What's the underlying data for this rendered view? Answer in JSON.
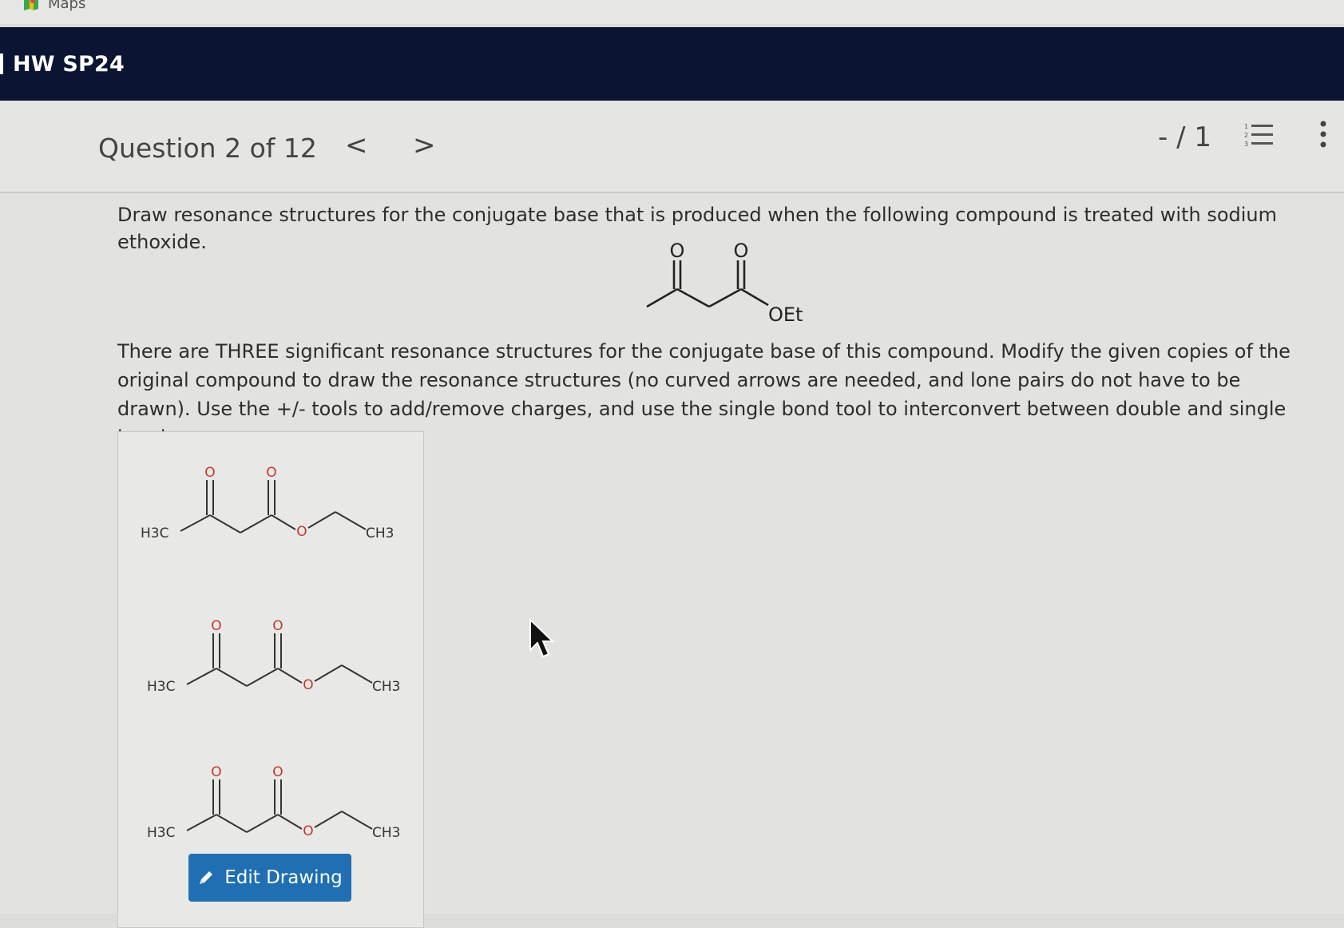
{
  "bookmarks": {
    "maps_label": "Maps",
    "icon": "maps-icon"
  },
  "header": {
    "title": "HW SP24"
  },
  "question_nav": {
    "label": "Question 2 of 12",
    "prev": "<",
    "next": ">",
    "score": "- / 1",
    "icons": [
      "prev-chevron-icon",
      "next-chevron-icon",
      "numbered-list-icon",
      "more-vertical-icon"
    ]
  },
  "question": {
    "prompt": "Draw resonance structures for the conjugate base that is produced when the following compound is treated with sodium ethoxide.",
    "instructions": "There are THREE significant resonance structures for the conjugate base of this compound. Modify the given copies of the original compound to draw the resonance structures (no curved arrows are needed, and lone pairs do not have to be drawn). Use the +/- tools to add/remove charges, and use the single bond tool to interconvert between double and single bonds.",
    "given_molecule": {
      "o1": "O",
      "o2": "O",
      "oet": "OEt"
    }
  },
  "drawing_panel": {
    "molecules": [
      {
        "left": "H3C",
        "o1": "O",
        "o2": "O",
        "ester_o": "O",
        "right": "CH3"
      },
      {
        "left": "H3C",
        "o1": "O",
        "o2": "O",
        "ester_o": "O",
        "right": "CH3"
      },
      {
        "left": "H3C",
        "o1": "O",
        "o2": "O",
        "ester_o": "O",
        "right": "CH3"
      }
    ],
    "edit_button": "Edit Drawing",
    "edit_icon": "pencil-icon"
  },
  "colors": {
    "header_bg": "#0b1533",
    "button_bg": "#1f6fb2",
    "oxygen_red": "#c0392b"
  }
}
